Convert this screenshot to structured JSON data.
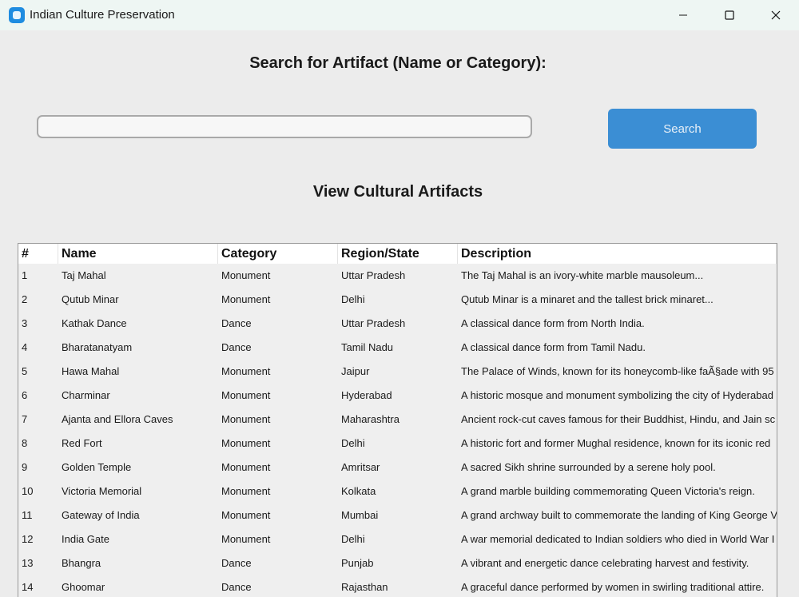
{
  "window": {
    "title": "Indian Culture Preservation"
  },
  "search": {
    "heading": "Search for Artifact (Name or Category):",
    "value": "",
    "placeholder": "",
    "button_label": "Search"
  },
  "view": {
    "heading": "View Cultural Artifacts"
  },
  "table": {
    "columns": [
      "#",
      "Name",
      "Category",
      "Region/State",
      "Description"
    ],
    "rows": [
      [
        "1",
        "Taj Mahal",
        "Monument",
        "Uttar Pradesh",
        "The Taj Mahal is an ivory-white marble mausoleum..."
      ],
      [
        "2",
        "Qutub Minar",
        "Monument",
        "Delhi",
        "Qutub Minar is a minaret and the tallest brick minaret..."
      ],
      [
        "3",
        "Kathak Dance",
        "Dance",
        "Uttar Pradesh",
        "A classical dance form from North India."
      ],
      [
        "4",
        "Bharatanatyam",
        "Dance",
        "Tamil Nadu",
        "A classical dance form from Tamil Nadu."
      ],
      [
        "5",
        "Hawa Mahal",
        "Monument",
        "Jaipur",
        "The Palace of Winds, known for its honeycomb-like faÃ§ade with 95"
      ],
      [
        "6",
        "Charminar",
        "Monument",
        "Hyderabad",
        "A historic mosque and monument symbolizing the city of Hyderabad"
      ],
      [
        "7",
        "Ajanta and Ellora Caves",
        "Monument",
        "Maharashtra",
        "Ancient rock-cut caves famous for their Buddhist, Hindu, and Jain sc"
      ],
      [
        "8",
        "Red Fort",
        "Monument",
        "Delhi",
        "A historic fort and former Mughal residence, known for its iconic red"
      ],
      [
        "9",
        "Golden Temple",
        "Monument",
        "Amritsar",
        "A sacred Sikh shrine surrounded by a serene holy pool."
      ],
      [
        "10",
        "Victoria Memorial",
        "Monument",
        "Kolkata",
        "A grand marble building commemorating Queen Victoria's reign."
      ],
      [
        "11",
        "Gateway of India",
        "Monument",
        "Mumbai",
        "A grand archway built to commemorate the landing of King George V"
      ],
      [
        "12",
        "India Gate",
        "Monument",
        "Delhi",
        "A war memorial dedicated to Indian soldiers who died in World War I"
      ],
      [
        "13",
        "Bhangra",
        "Dance",
        "Punjab",
        "A vibrant and energetic dance celebrating harvest and festivity."
      ],
      [
        "14",
        "Ghoomar",
        "Dance",
        "Rajasthan",
        "A graceful dance performed by women in swirling traditional attire."
      ]
    ]
  },
  "colors": {
    "accent": "#3b8ed4",
    "background": "#ececec",
    "titlebar": "#eef6f3"
  },
  "icons": {
    "app": "app-icon",
    "minimize": "minimize-icon",
    "maximize": "maximize-icon",
    "close": "close-icon"
  }
}
